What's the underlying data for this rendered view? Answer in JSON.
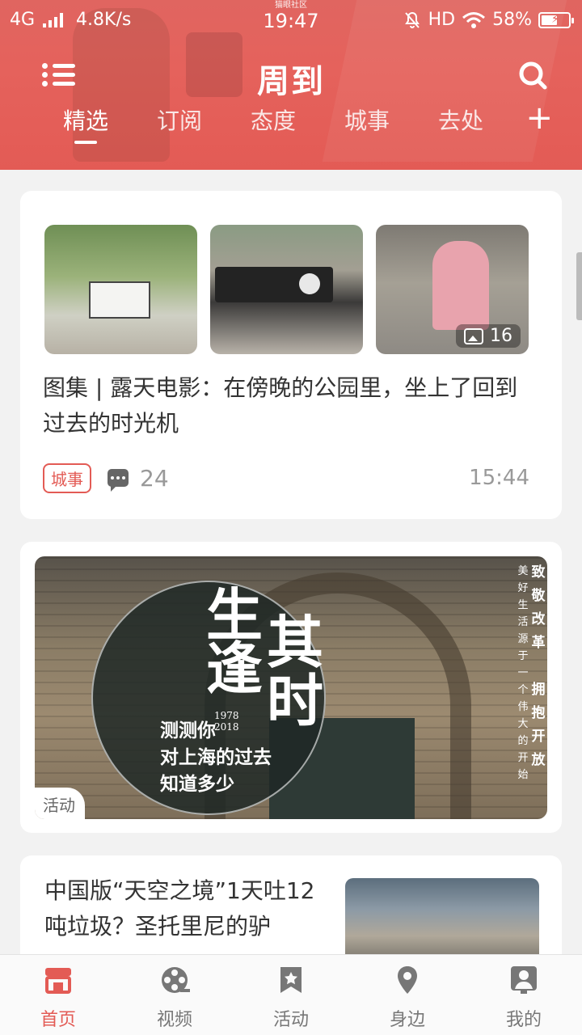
{
  "status_bar": {
    "network": "4G",
    "speed": "4.8K/s",
    "carrier_note": "猫眼社区",
    "time": "19:47",
    "hd": "HD",
    "battery": "58%",
    "battery_level": 0.58
  },
  "header": {
    "app_title": "周到",
    "tabs": [
      "精选",
      "订阅",
      "态度",
      "城事",
      "去处"
    ],
    "active_tab": "精选",
    "add_label": "+"
  },
  "feed": {
    "gallery_post": {
      "title": "图集 | 露天电影：在傍晚的公园里，坐上了回到过去的时光机",
      "photo_count": "16",
      "tag": "城事",
      "comments": "24",
      "time": "15:44"
    },
    "banner_post": {
      "headline_chars": [
        "生",
        "逢",
        "其",
        "时"
      ],
      "years_top": "1978",
      "years_bottom": "2018",
      "subtitle_lines": [
        "测测你",
        "对上海的过去",
        "知道多少"
      ],
      "vertical_small": "美好生活源于一个伟大的开始",
      "vertical_large": "致敬改革 拥抱开放",
      "label": "活动"
    },
    "article_post": {
      "title": "中国版“天空之境”1天吐12吨垃圾？圣托里尼的驴"
    }
  },
  "bottom_nav": {
    "items": [
      {
        "label": "首页",
        "icon": "home-shop-icon",
        "active": true
      },
      {
        "label": "视频",
        "icon": "film-reel-icon",
        "active": false
      },
      {
        "label": "活动",
        "icon": "star-bookmark-icon",
        "active": false
      },
      {
        "label": "身边",
        "icon": "location-pin-icon",
        "active": false
      },
      {
        "label": "我的",
        "icon": "user-profile-icon",
        "active": false
      }
    ]
  },
  "colors": {
    "brand": "#e35b55",
    "text_primary": "#333333",
    "text_secondary": "#999999"
  }
}
